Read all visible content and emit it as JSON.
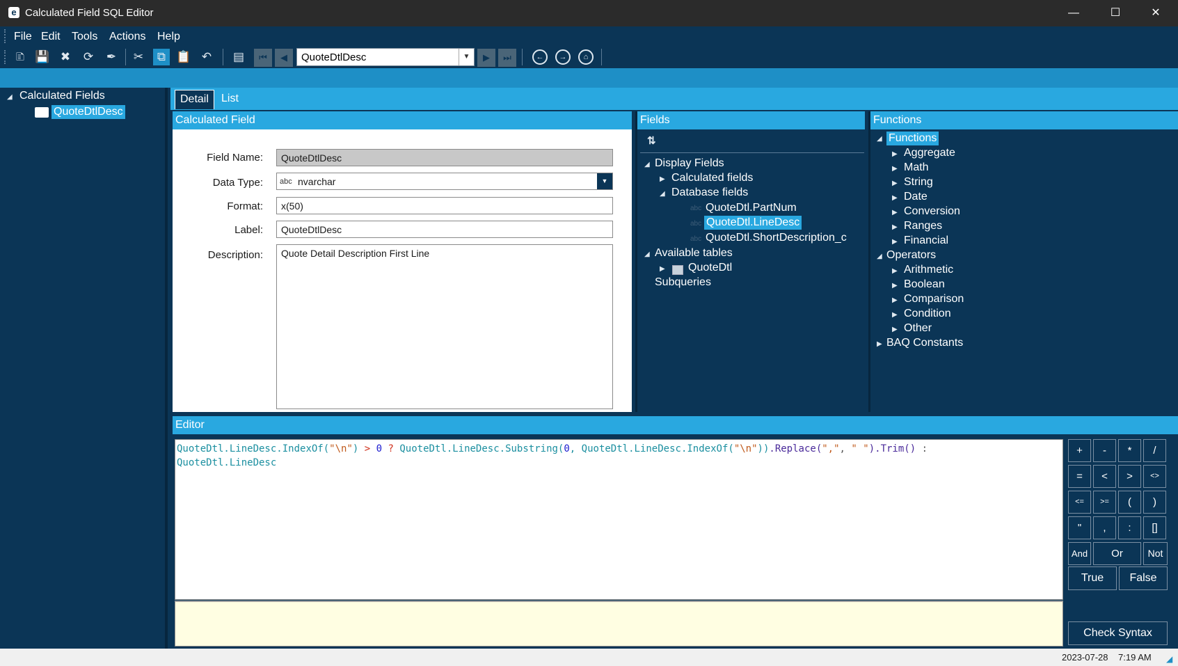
{
  "window": {
    "title": "Calculated Field SQL Editor",
    "app_icon": "e"
  },
  "menu": [
    "File",
    "Edit",
    "Tools",
    "Actions",
    "Help"
  ],
  "toolbar": {
    "record_value": "QuoteDtlDesc"
  },
  "left_tree": {
    "root": "Calculated Fields",
    "child": "QuoteDtlDesc"
  },
  "tabs": {
    "detail": "Detail",
    "list": "List"
  },
  "calc_field": {
    "header": "Calculated Field",
    "field_name_label": "Field Name:",
    "field_name": "QuoteDtlDesc",
    "data_type_label": "Data Type:",
    "data_type_prefix": "abc",
    "data_type": "nvarchar",
    "format_label": "Format:",
    "format": "x(50)",
    "label_label": "Label:",
    "label": "QuoteDtlDesc",
    "description_label": "Description:",
    "description": "Quote Detail Description First Line"
  },
  "fields": {
    "header": "Fields",
    "display_fields": "Display Fields",
    "calculated_fields": "Calculated fields",
    "database_fields": "Database fields",
    "db_items": [
      "QuoteDtl.PartNum",
      "QuoteDtl.LineDesc",
      "QuoteDtl.ShortDescription_c"
    ],
    "available_tables": "Available tables",
    "table": "QuoteDtl",
    "subqueries": "Subqueries"
  },
  "functions": {
    "header": "Functions",
    "root": "Functions",
    "function_items": [
      "Aggregate",
      "Math",
      "String",
      "Date",
      "Conversion",
      "Ranges",
      "Financial"
    ],
    "operators": "Operators",
    "operator_items": [
      "Arithmetic",
      "Boolean",
      "Comparison",
      "Condition",
      "Other"
    ],
    "constants": "BAQ Constants"
  },
  "editor": {
    "header": "Editor",
    "line1": {
      "a": "QuoteDtl.LineDesc",
      "b": ".IndexOf(",
      "c": "\"\\n\"",
      "d": ") ",
      "e": ">",
      "f": " ",
      "g": "0",
      "h": " ",
      "i": "?",
      "j": " QuoteDtl.LineDesc",
      "k": ".Substring(",
      "l": "0",
      "m": ", QuoteDtl.LineDesc",
      "n": ".IndexOf(",
      "o": "\"\\n\"",
      "p": "))",
      "q": ".Replace(",
      "r": "\",\"",
      "s": ", ",
      "t": "\" \"",
      "u": ")",
      "v": ".Trim()",
      "w": " :"
    },
    "line2": "QuoteDtl.LineDesc"
  },
  "operators_pad": [
    "+",
    "-",
    "*",
    "/",
    "=",
    "<",
    ">",
    "<>",
    "<=",
    ">=",
    "(",
    ")",
    "\"",
    ",",
    ":",
    "[]",
    "And",
    "Or",
    "Not",
    "True",
    "False"
  ],
  "check_syntax": "Check Syntax",
  "status": {
    "date": "2023-07-28",
    "time": "7:19 AM"
  }
}
